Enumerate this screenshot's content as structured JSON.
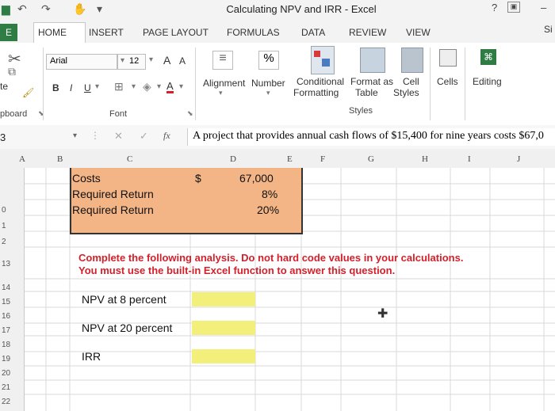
{
  "window": {
    "title": "Calculating NPV and IRR - Excel",
    "help": "?",
    "minimize": "–",
    "signin": "Si"
  },
  "tabs": [
    "HOME",
    "INSERT",
    "PAGE LAYOUT",
    "FORMULAS",
    "DATA",
    "REVIEW",
    "VIEW"
  ],
  "file_tab": "E",
  "ribbon": {
    "font_name": "Arial",
    "font_size": "12",
    "paste_fragment": "te",
    "clipboard_fragment": "pboard",
    "font_group": "Font",
    "alignment": "Alignment",
    "number": "Number",
    "percent": "%",
    "cond_format_1": "Conditional",
    "cond_format_2": "Formatting",
    "format_table_1": "Format as",
    "format_table_2": "Table",
    "cell_styles_1": "Cell",
    "cell_styles_2": "Styles",
    "cells": "Cells",
    "editing": "Editing",
    "styles_group": "Styles",
    "bold": "B",
    "italic": "I",
    "underline": "U",
    "grow_font": "A",
    "shrink_font": "A",
    "font_color": "A"
  },
  "formula_bar": {
    "name_box": "3",
    "fx": "fx",
    "content": "A project that provides annual cash flows of $15,400 for nine years costs $67,0"
  },
  "columns": [
    "A",
    "B",
    "C",
    "D",
    "E",
    "F",
    "G",
    "H",
    "I",
    "J"
  ],
  "rows": [
    "0",
    "1",
    "2",
    "13",
    "14",
    "15",
    "16",
    "17",
    "18",
    "19",
    "20",
    "21",
    "22"
  ],
  "sheet": {
    "costs_label": "Costs",
    "costs_currency": "$",
    "costs_value": "67,000",
    "required_return_1_label": "Required Return",
    "required_return_1_value": "8%",
    "required_return_2_label": "Required Return",
    "required_return_2_value": "20%",
    "instruction_line1": "Complete the following analysis. Do not hard code values in your calculations.",
    "instruction_line2": "You must use the built-in Excel function to answer this question.",
    "npv8_label": "NPV at 8 percent",
    "npv20_label": "NPV at 20 percent",
    "irr_label": "IRR"
  },
  "colors": {
    "input_fill": "#f3b586",
    "answer_fill": "#f2f07a",
    "excel_green": "#2f7d44",
    "instruction_red": "#d4202a"
  }
}
